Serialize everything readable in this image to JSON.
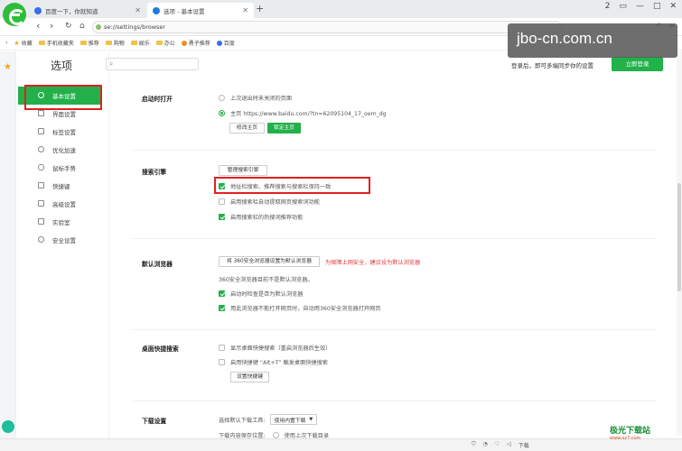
{
  "tabs": [
    {
      "title": "百度一下，你就知道"
    },
    {
      "title": "选项 - 基本设置"
    }
  ],
  "tab_new_label": "+",
  "window_controls": [
    "2",
    "▭",
    "—",
    "□",
    "✕"
  ],
  "address": {
    "url": "se://settings/browser"
  },
  "bookmarks": [
    "收藏",
    "手机收藏夹",
    "推荐",
    "购物",
    "娱乐",
    "办公",
    "勇子推荐",
    "百度"
  ],
  "watermark": "jbo-cn.com.cn",
  "settings": {
    "title": "选项",
    "login_tip": "登录后，即可多端同步你的设置",
    "login_button": "立即登录"
  },
  "menu": [
    {
      "label": "基本设置",
      "active": true
    },
    {
      "label": "界面设置"
    },
    {
      "label": "标签设置"
    },
    {
      "label": "优化加速"
    },
    {
      "label": "鼠标手势"
    },
    {
      "label": "快捷键"
    },
    {
      "label": "高级设置"
    },
    {
      "label": "实验室"
    },
    {
      "label": "安全设置"
    }
  ],
  "startup": {
    "title": "启动时打开",
    "opt1": "上次退出时未关闭的页面",
    "opt2": "主页 https://www.baidu.com/?tn=62095104_17_oem_dg",
    "btn_modify": "修改主页",
    "btn_lock": "锁定主页"
  },
  "search": {
    "title": "搜索引擎",
    "manage_btn": "管理搜索引擎",
    "opt1": "地址栏搜索、推荐搜索与搜索栏保持一致",
    "opt2": "启用搜索栏自动提取网页搜索词功能",
    "opt3": "启用搜索栏的热搜词推荐功能"
  },
  "default_browser": {
    "title": "默认浏览器",
    "set_btn": "将 360安全浏览器设置为默认浏览器",
    "warning": "为保障上网安全，建议设为默认浏览器",
    "status": "360安全浏览器目前不是默认浏览器。",
    "opt1": "启动时检查是否为默认浏览器",
    "opt2": "用此浏览器不能打开网页时，自动用360安全浏览器打开网页"
  },
  "desktop_search": {
    "title": "桌面快捷搜索",
    "opt1": "显示桌面快捷搜索（重启浏览器后生效）",
    "opt2": "启用快捷键 “Alt+T” 触发桌面快捷搜索",
    "btn": "设置快捷键"
  },
  "download": {
    "title": "下载设置",
    "tool_label": "选择默认下载工具:",
    "tool_value": "使用内置下载",
    "save_label": "下载内容保存位置:",
    "save_value": "使用上次下载目录"
  },
  "status_bar": [
    "下载"
  ],
  "corner_logo": {
    "main": "极光下载站",
    "sub": "www.xz7.com"
  }
}
